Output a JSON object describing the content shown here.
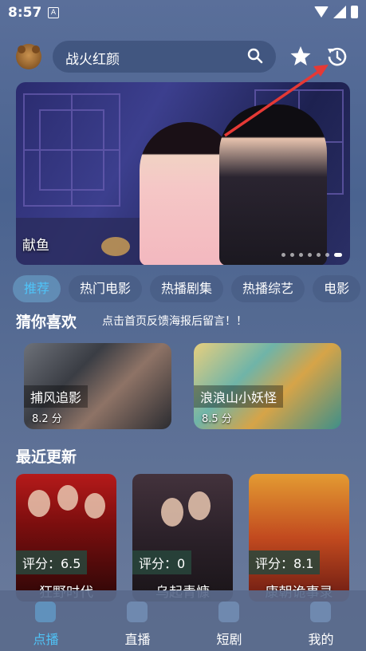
{
  "status_bar": {
    "time": "8:57",
    "notification_icon": "A"
  },
  "header": {
    "search_query": "战火红颜",
    "icons": [
      "avatar",
      "search-icon",
      "star-icon",
      "history-icon"
    ]
  },
  "banner": {
    "title": "献鱼",
    "page_count": 7,
    "active_page": 7
  },
  "categories": [
    "推荐",
    "热门电影",
    "热播剧集",
    "热播综艺",
    "电影"
  ],
  "categories_active": "推荐",
  "guess_like": {
    "heading": "猜你喜欢",
    "notice": "点击首页反馈海报后留言！！",
    "items": [
      {
        "title": "捕风追影",
        "score": "8.2 分"
      },
      {
        "title": "浪浪山小妖怪",
        "score": "8.5 分"
      }
    ]
  },
  "recent": {
    "heading": "最近更新",
    "items": [
      {
        "rating": "评分：6.5",
        "title": "狂野时代"
      },
      {
        "rating": "评分：0",
        "title": "乌起青慷"
      },
      {
        "rating": "评分：8.1",
        "title": "康朝诡事录"
      }
    ]
  },
  "bottom_nav": [
    {
      "label": "点播",
      "active": true
    },
    {
      "label": "直播",
      "active": false
    },
    {
      "label": "短剧",
      "active": false
    },
    {
      "label": "我的",
      "active": false
    }
  ],
  "colors": {
    "accent": "#4fc3f7",
    "annotation_arrow": "#e53935"
  }
}
